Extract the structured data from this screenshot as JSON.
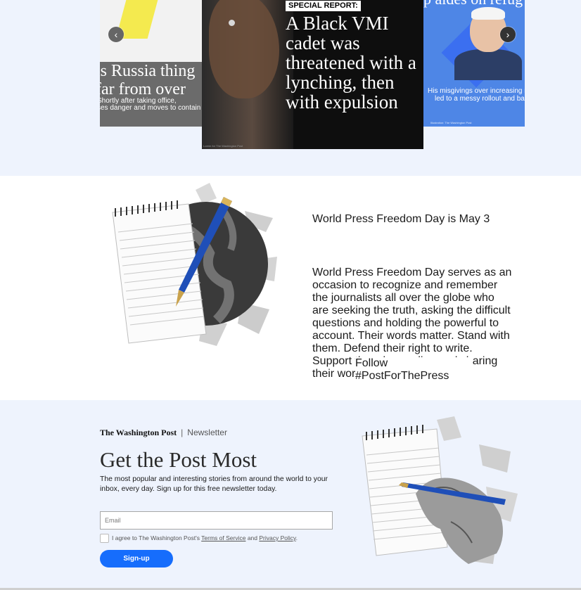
{
  "carousel": {
    "left_slide": {
      "headline_line1": "is Russia thing",
      "headline_line2": "far from over",
      "text_line1": "Shortly after taking office,",
      "text_line2": "ses danger and moves to contain i"
    },
    "main_slide": {
      "kicker": "SPECIAL REPORT:",
      "headline": "A Black VMI cadet was threatened with a lynching, then with expulsion",
      "credit": "Lorem for The Washington Post"
    },
    "right_slide": {
      "top_text": "p aides on refug",
      "caption_line1": "His misgivings over increasing nu",
      "caption_line2": "led to a messy rollout and bac",
      "credit": "Illustration: The Washington Post"
    },
    "prev_icon": "chevron-left-icon",
    "next_icon": "chevron-right-icon"
  },
  "freedom": {
    "title": "World Press Freedom Day is May 3",
    "body": "World Press Freedom Day serves as an occasion to recognize and remember the journalists all over the globe who are seeking the truth, asking the difficult questions and holding the powerful to account. Their words matter. Stand with them. Defend their right to write. Support them by reading and sharing their work.",
    "button": "Follow #PostForThePress"
  },
  "newsletter": {
    "brand": "The Washington Post",
    "separator": "|",
    "label": "Newsletter",
    "title": "Get the Post Most",
    "description": "The most popular and interesting stories from around the world to your inbox, every day. Sign up for this free newsletter today.",
    "email_placeholder": "Email",
    "email_value": "",
    "agree_prefix": "I agree to The Washington Post's ",
    "terms_link": "Terms of Service",
    "agree_and": " and ",
    "privacy_link": "Privacy Policy",
    "agree_suffix": ".",
    "signup_button": "Sign-up"
  },
  "colors": {
    "accent": "#166dfc",
    "page_bg": "#eef3fd"
  }
}
